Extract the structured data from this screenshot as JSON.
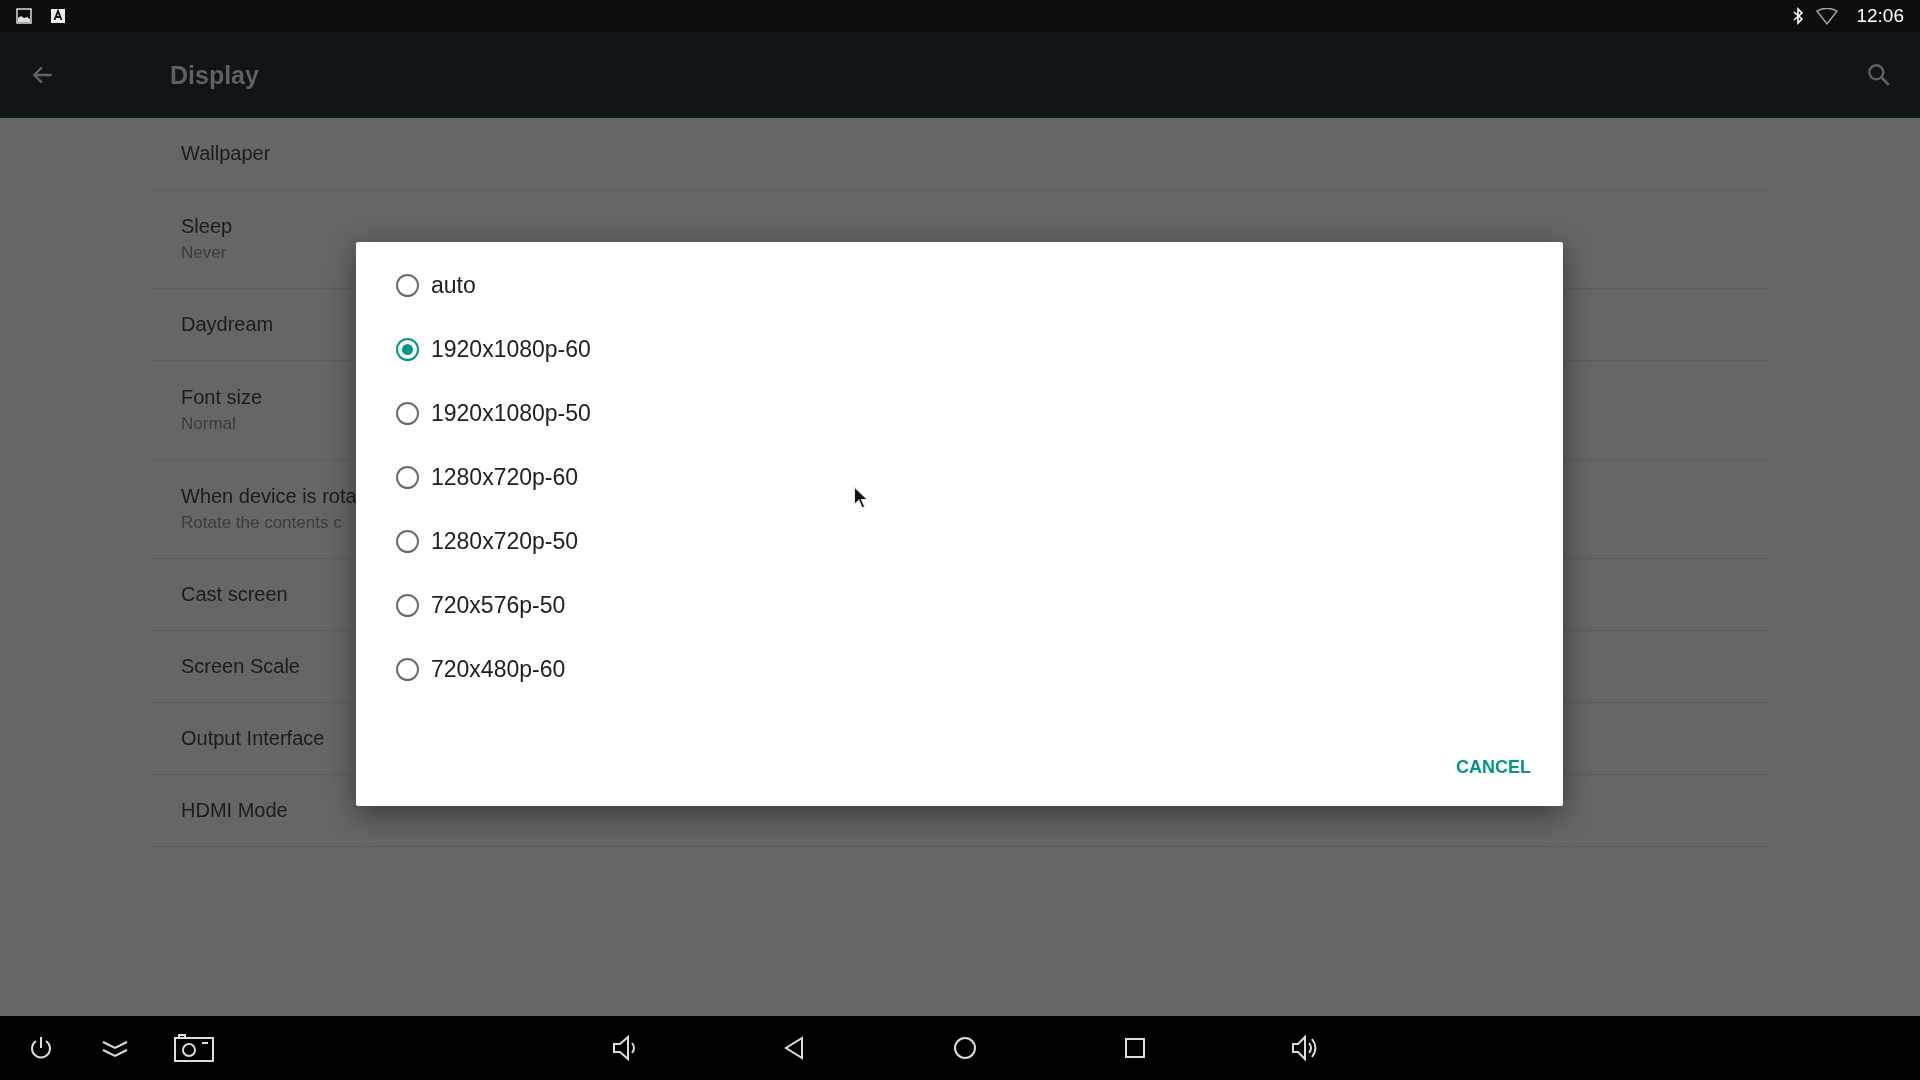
{
  "status_bar": {
    "time": "12:06"
  },
  "toolbar": {
    "title": "Display"
  },
  "settings": [
    {
      "title": "Wallpaper"
    },
    {
      "title": "Sleep",
      "summary": "Never"
    },
    {
      "title": "Daydream"
    },
    {
      "title": "Font size",
      "summary": "Normal"
    },
    {
      "title": "When device is rota",
      "summary": "Rotate the contents c"
    },
    {
      "title": "Cast screen"
    },
    {
      "title": "Screen Scale"
    },
    {
      "title": "Output Interface"
    },
    {
      "title": "HDMI Mode"
    }
  ],
  "dialog": {
    "options": [
      {
        "label": "auto",
        "selected": false
      },
      {
        "label": "1920x1080p-60",
        "selected": true
      },
      {
        "label": "1920x1080p-50",
        "selected": false
      },
      {
        "label": "1280x720p-60",
        "selected": false
      },
      {
        "label": "1280x720p-50",
        "selected": false
      },
      {
        "label": "720x576p-50",
        "selected": false
      },
      {
        "label": "720x480p-60",
        "selected": false
      }
    ],
    "button": "CANCEL"
  }
}
